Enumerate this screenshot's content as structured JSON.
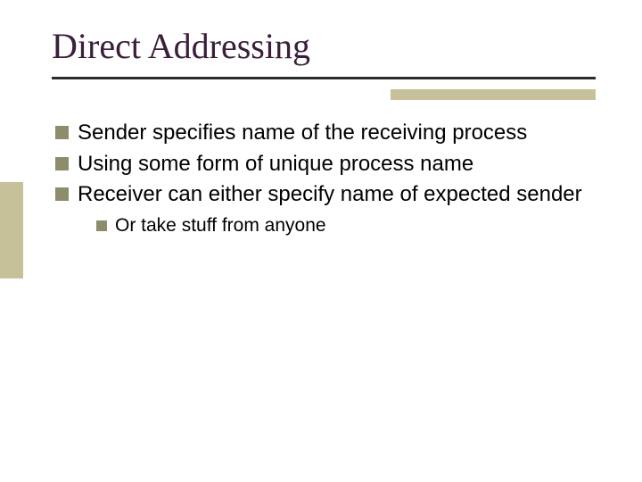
{
  "title": "Direct Addressing",
  "bullets": [
    "Sender specifies name of the receiving process",
    "Using some form of unique process name",
    "Receiver can either specify name of expected sender"
  ],
  "sub_bullets": [
    "Or take stuff from anyone"
  ]
}
